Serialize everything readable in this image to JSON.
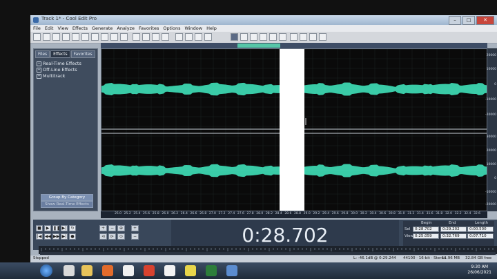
{
  "window": {
    "title": "Track 1* - Cool Edit Pro"
  },
  "menu": [
    "File",
    "Edit",
    "View",
    "Effects",
    "Generate",
    "Analyze",
    "Favorites",
    "Options",
    "Window",
    "Help"
  ],
  "left_panel": {
    "tabs": [
      "Files",
      "Effects",
      "Favorites"
    ],
    "tree": [
      "Real-Time Effects",
      "Off-Line Effects",
      "Multitrack"
    ],
    "group_button": "Group By Category",
    "show_button": "Show Real-Time Effects"
  },
  "db_axis": [
    "20000",
    "10000",
    "0",
    "-10000",
    "-20000",
    "30000",
    "20000",
    "10000",
    "0",
    "-10000",
    "-20000"
  ],
  "time_axis": [
    "25.0",
    "25.2",
    "25.4",
    "25.6",
    "25.8",
    "26.0",
    "26.2",
    "26.4",
    "26.6",
    "26.8",
    "27.0",
    "27.2",
    "27.4",
    "27.6",
    "27.8",
    "28.0",
    "28.2",
    "28.4",
    "28.6",
    "28.8",
    "29.0",
    "29.2",
    "29.4",
    "29.6",
    "29.8",
    "30.0",
    "30.2",
    "30.4",
    "30.6",
    "30.8",
    "31.0",
    "31.2",
    "31.4",
    "31.6",
    "31.8",
    "32.0",
    "32.2",
    "32.4",
    "32.6"
  ],
  "time_display": "0:28.702",
  "selection": {
    "headers": [
      "Begin",
      "End",
      "Length"
    ],
    "sel_label": "Sel",
    "view_label": "View",
    "sel": [
      "0:28.702",
      "0:29.202",
      "0:00.500"
    ],
    "view": [
      "0:25.059",
      "0:32.769",
      "0:07.710"
    ]
  },
  "status": {
    "left": "Stopped",
    "info": "L: -46.1dB @ 0:29.244",
    "rate": "44100 · 16-bit · Stereo",
    "size": "11.96 MB",
    "free": "32.84 GB free"
  },
  "clock": {
    "time": "9:30 AM",
    "date": "26/06/2021"
  },
  "colors": {
    "waveform": "#3fe0b8",
    "selection": "#ffffff",
    "panel": "#3f4c5e"
  }
}
